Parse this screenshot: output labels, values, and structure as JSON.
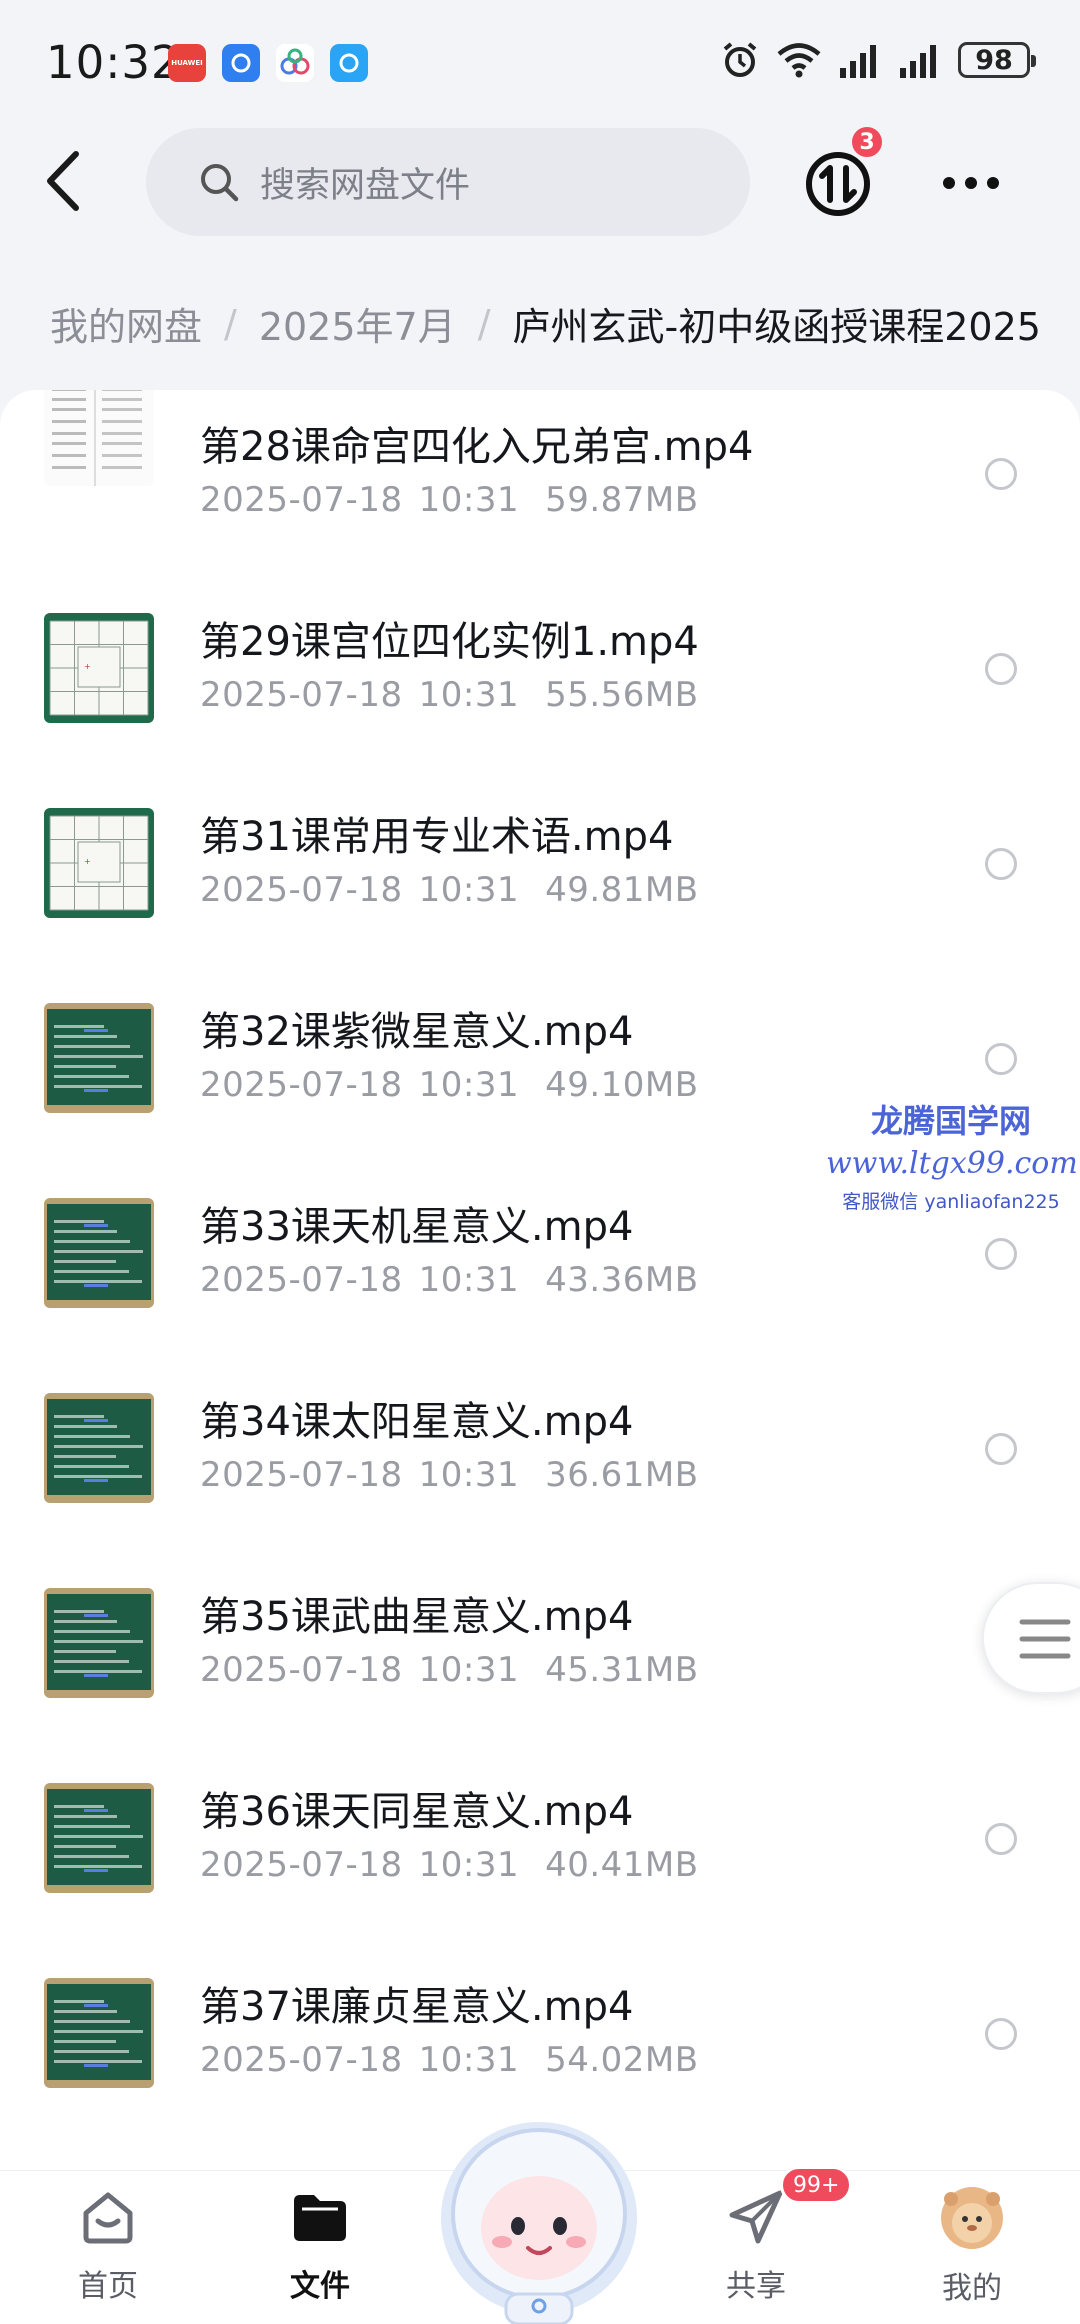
{
  "status_bar": {
    "time": "10:32",
    "battery": "98",
    "app_icons": [
      {
        "name": "huawei-app-icon",
        "color": "#e8423c",
        "label": "HUAWEI"
      },
      {
        "name": "cloud-app-icon",
        "color": "#2f7ff0",
        "label": ""
      },
      {
        "name": "baidu-netdisk-icon",
        "color": "#ffffff",
        "label": ""
      },
      {
        "name": "browser-app-icon",
        "color": "#2aa4f4",
        "label": ""
      }
    ]
  },
  "header": {
    "search_placeholder": "搜索网盘文件",
    "transfer_badge": "3"
  },
  "breadcrumb": {
    "root": "我的网盘",
    "folder": "2025年7月",
    "current": "庐州玄武-初中级函授课程2025"
  },
  "files": [
    {
      "title": "第28课命宫四化入兄弟宫.mp4",
      "date": "2025-07-18",
      "time": "10:31",
      "size": "59.87MB",
      "thumb": "document"
    },
    {
      "title": "第29课宫位四化实例1.mp4",
      "date": "2025-07-18",
      "time": "10:31",
      "size": "55.56MB",
      "thumb": "chart"
    },
    {
      "title": "第31课常用专业术语.mp4",
      "date": "2025-07-18",
      "time": "10:31",
      "size": "49.81MB",
      "thumb": "chart"
    },
    {
      "title": "第32课紫微星意义.mp4",
      "date": "2025-07-18",
      "time": "10:31",
      "size": "49.10MB",
      "thumb": "board"
    },
    {
      "title": "第33课天机星意义.mp4",
      "date": "2025-07-18",
      "time": "10:31",
      "size": "43.36MB",
      "thumb": "board"
    },
    {
      "title": "第34课太阳星意义.mp4",
      "date": "2025-07-18",
      "time": "10:31",
      "size": "36.61MB",
      "thumb": "board"
    },
    {
      "title": "第35课武曲星意义.mp4",
      "date": "2025-07-18",
      "time": "10:31",
      "size": "45.31MB",
      "thumb": "board"
    },
    {
      "title": "第36课天同星意义.mp4",
      "date": "2025-07-18",
      "time": "10:31",
      "size": "40.41MB",
      "thumb": "board"
    },
    {
      "title": "第37课廉贞星意义.mp4",
      "date": "2025-07-18",
      "time": "10:31",
      "size": "54.02MB",
      "thumb": "board"
    }
  ],
  "watermark": {
    "line1": "龙腾国学网",
    "line2": "www.ltgx99.com",
    "line3": "客服微信 yanliaofan225"
  },
  "bottom_nav": {
    "home": "首页",
    "files": "文件",
    "share": "共享",
    "share_badge": "99+",
    "mine": "我的"
  },
  "colors": {
    "accent_badge": "#f04b5d",
    "background": "#f3f4f7",
    "board_green": "#1f6a4a"
  }
}
